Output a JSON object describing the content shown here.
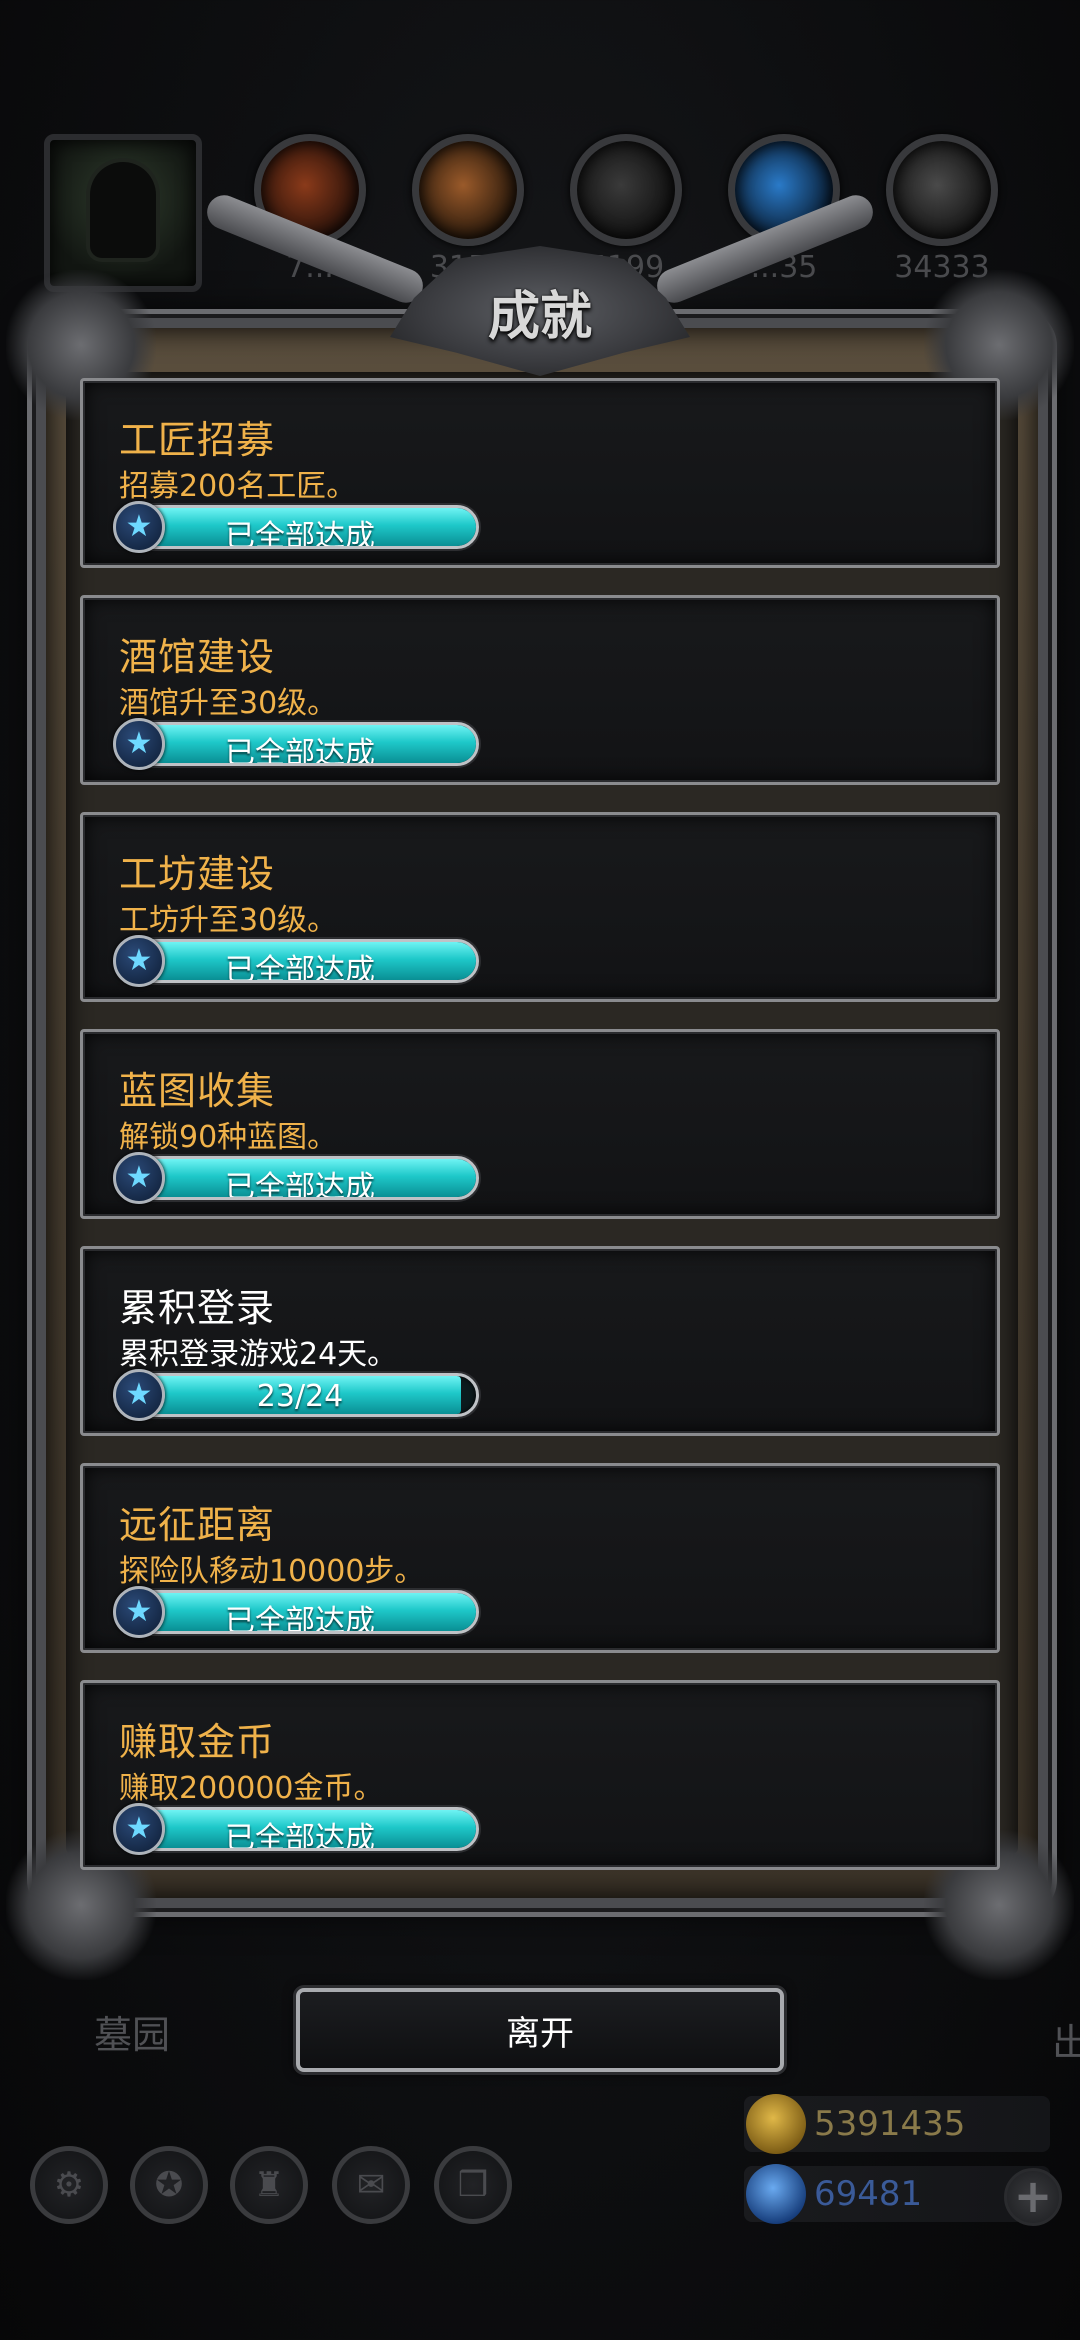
{
  "topbar": {
    "resources": [
      {
        "icon": "meat-icon",
        "count": "7...",
        "color": "#8a3a1a"
      },
      {
        "icon": "wood-icon",
        "count": "3156",
        "color": "#9a5a2a"
      },
      {
        "icon": "iron-icon",
        "count": "5199",
        "color": "#3a3a3a"
      },
      {
        "icon": "crystal-icon",
        "count": "...35",
        "color": "#2a7ac8"
      },
      {
        "icon": "stone-icon",
        "count": "34333",
        "color": "#4a4a4a"
      }
    ]
  },
  "modal": {
    "title": "成就"
  },
  "achievements": [
    {
      "name": "工匠招募",
      "desc": "招募200名工匠。",
      "progress_label": "已全部达成",
      "progress": 1.0,
      "complete": true
    },
    {
      "name": "酒馆建设",
      "desc": "酒馆升至30级。",
      "progress_label": "已全部达成",
      "progress": 1.0,
      "complete": true
    },
    {
      "name": "工坊建设",
      "desc": "工坊升至30级。",
      "progress_label": "已全部达成",
      "progress": 1.0,
      "complete": true
    },
    {
      "name": "蓝图收集",
      "desc": "解锁90种蓝图。",
      "progress_label": "已全部达成",
      "progress": 1.0,
      "complete": true
    },
    {
      "name": "累积登录",
      "desc": "累积登录游戏24天。",
      "progress_label": "23/24",
      "progress": 0.958,
      "complete": false
    },
    {
      "name": "远征距离",
      "desc": "探险队移动10000步。",
      "progress_label": "已全部达成",
      "progress": 1.0,
      "complete": true
    },
    {
      "name": "赚取金币",
      "desc": "赚取200000金币。",
      "progress_label": "已全部达成",
      "progress": 1.0,
      "complete": true
    }
  ],
  "leave_button": "离开",
  "background": {
    "left_label": "墓园",
    "right_label": "出"
  },
  "currencies": {
    "gold": {
      "value": "5391435",
      "icon": "gold-coin-icon",
      "color": "#b8902a"
    },
    "gems": {
      "value": "69481",
      "icon": "gem-icon",
      "color": "#3a7ad8"
    }
  },
  "colors": {
    "title_gold": "#f0b24a",
    "bar_cyan": "#1ec8c9"
  }
}
